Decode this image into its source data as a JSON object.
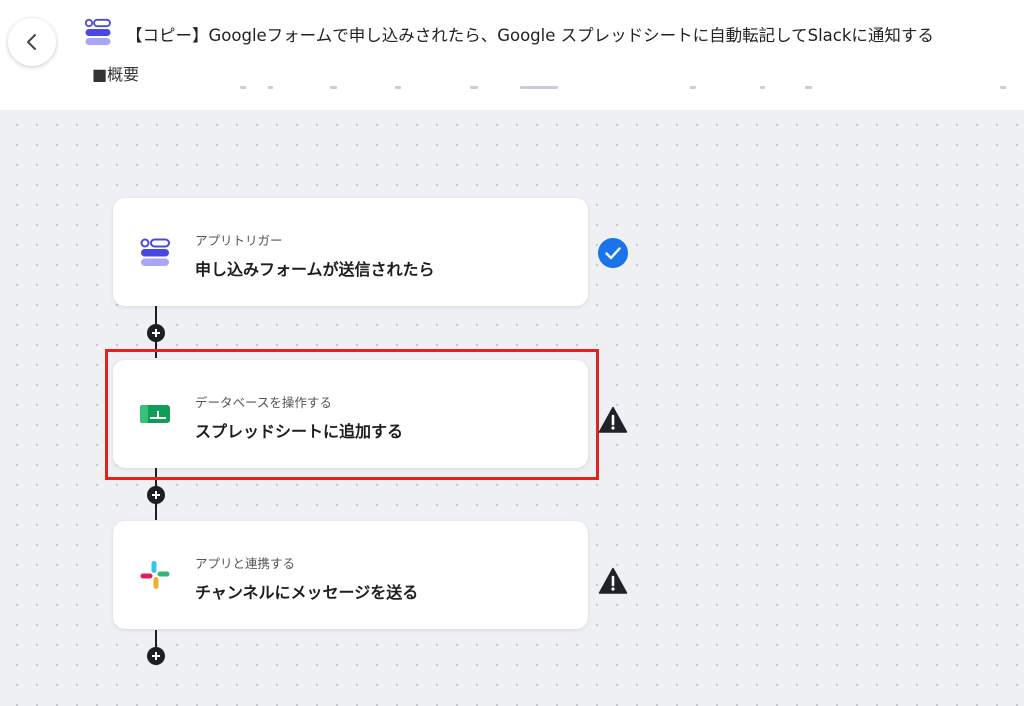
{
  "header": {
    "back_icon": "chevron-left-icon",
    "app_icon": "form-app-icon",
    "title": "【コピー】Googleフォームで申し込みされたら、Google スプレッドシートに自動転記してSlackに通知する",
    "summary_label": "■概要"
  },
  "steps": [
    {
      "type_label": "アプリトリガー",
      "name": "申し込みフォームが送信されたら",
      "icon": "form-trigger-icon",
      "status": "complete-check-icon",
      "status_color": "#1a73e8"
    },
    {
      "type_label": "データベースを操作する",
      "name": "スプレッドシートに追加する",
      "icon": "google-sheets-icon",
      "status": "warning-icon",
      "status_color": "#1f2328",
      "highlighted": true
    },
    {
      "type_label": "アプリと連携する",
      "name": "チャンネルにメッセージを送る",
      "icon": "slack-icon",
      "status": "warning-icon",
      "status_color": "#1f2328"
    }
  ],
  "colors": {
    "highlight": "#e0241b",
    "canvas_bg": "#eef0f4",
    "accent_blue": "#1a73e8"
  }
}
